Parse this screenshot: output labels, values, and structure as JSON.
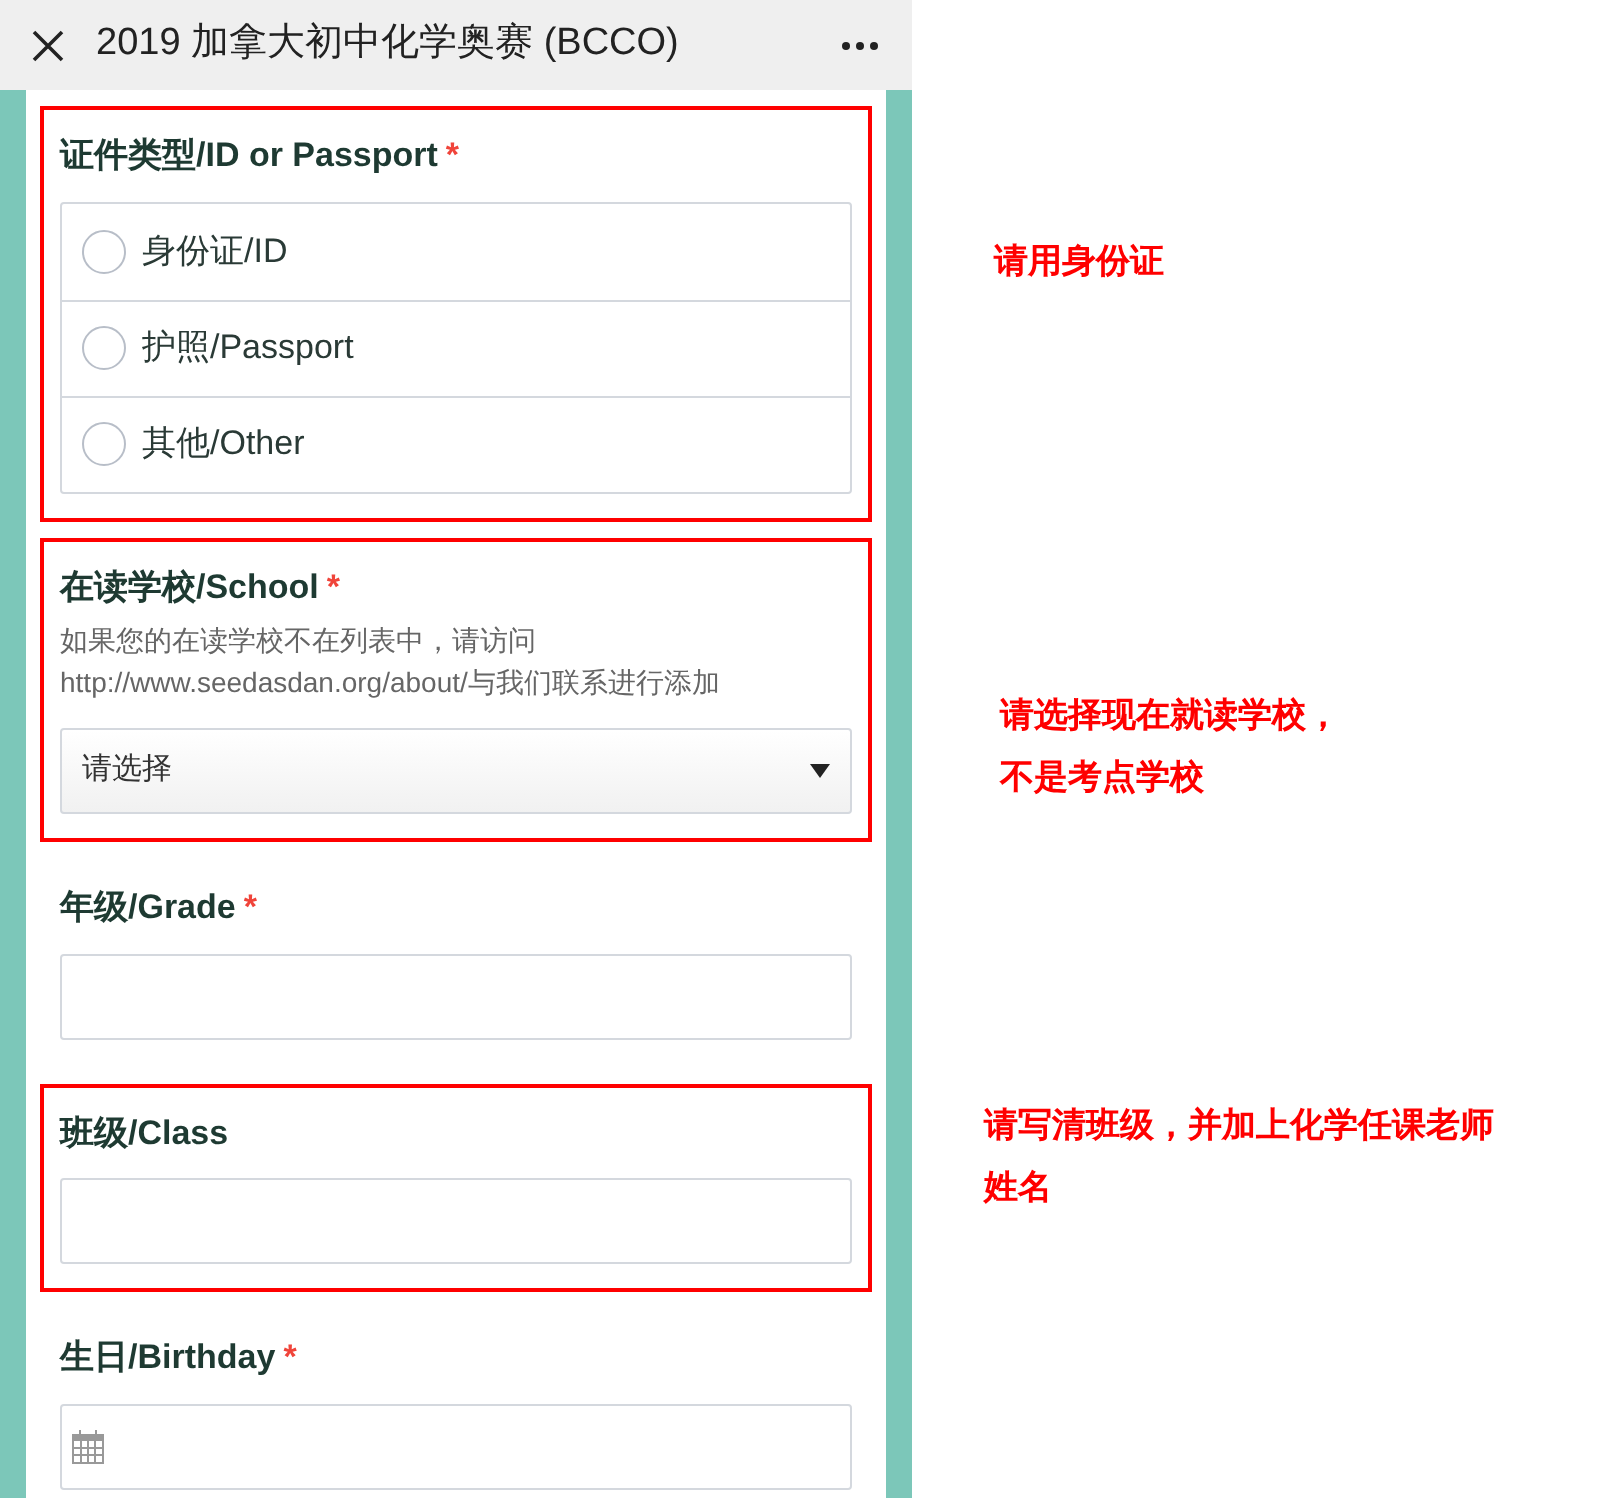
{
  "header": {
    "title": "2019 加拿大初中化学奥赛 (BCCO)"
  },
  "fields": [
    {
      "kind": "radio",
      "label": "证件类型/ID or Passport",
      "required_mark": "*",
      "highlighted": true,
      "options": [
        {
          "label": "身份证/ID",
          "selected": false
        },
        {
          "label": "护照/Passport",
          "selected": false
        },
        {
          "label": "其他/Other",
          "selected": false
        }
      ]
    },
    {
      "kind": "select",
      "label": "在读学校/School",
      "required_mark": "*",
      "highlighted": true,
      "help": "如果您的在读学校不在列表中，请访问\nhttp://www.seedasdan.org/about/与我们联系进行添加",
      "value": "请选择"
    },
    {
      "kind": "text",
      "label": "年级/Grade",
      "required_mark": "*",
      "highlighted": false
    },
    {
      "kind": "text",
      "label": "班级/Class",
      "highlighted": true
    },
    {
      "kind": "date",
      "label": "生日/Birthday",
      "required_mark": "*",
      "highlighted": false
    }
  ],
  "annotations": [
    {
      "text": "请用身份证"
    },
    {
      "text": "请选择现在就读学校，",
      "continuation": "不是考点学校"
    },
    {
      "text": "请写清班级，并加上化学任课老师",
      "continuation": "姓名"
    }
  ]
}
